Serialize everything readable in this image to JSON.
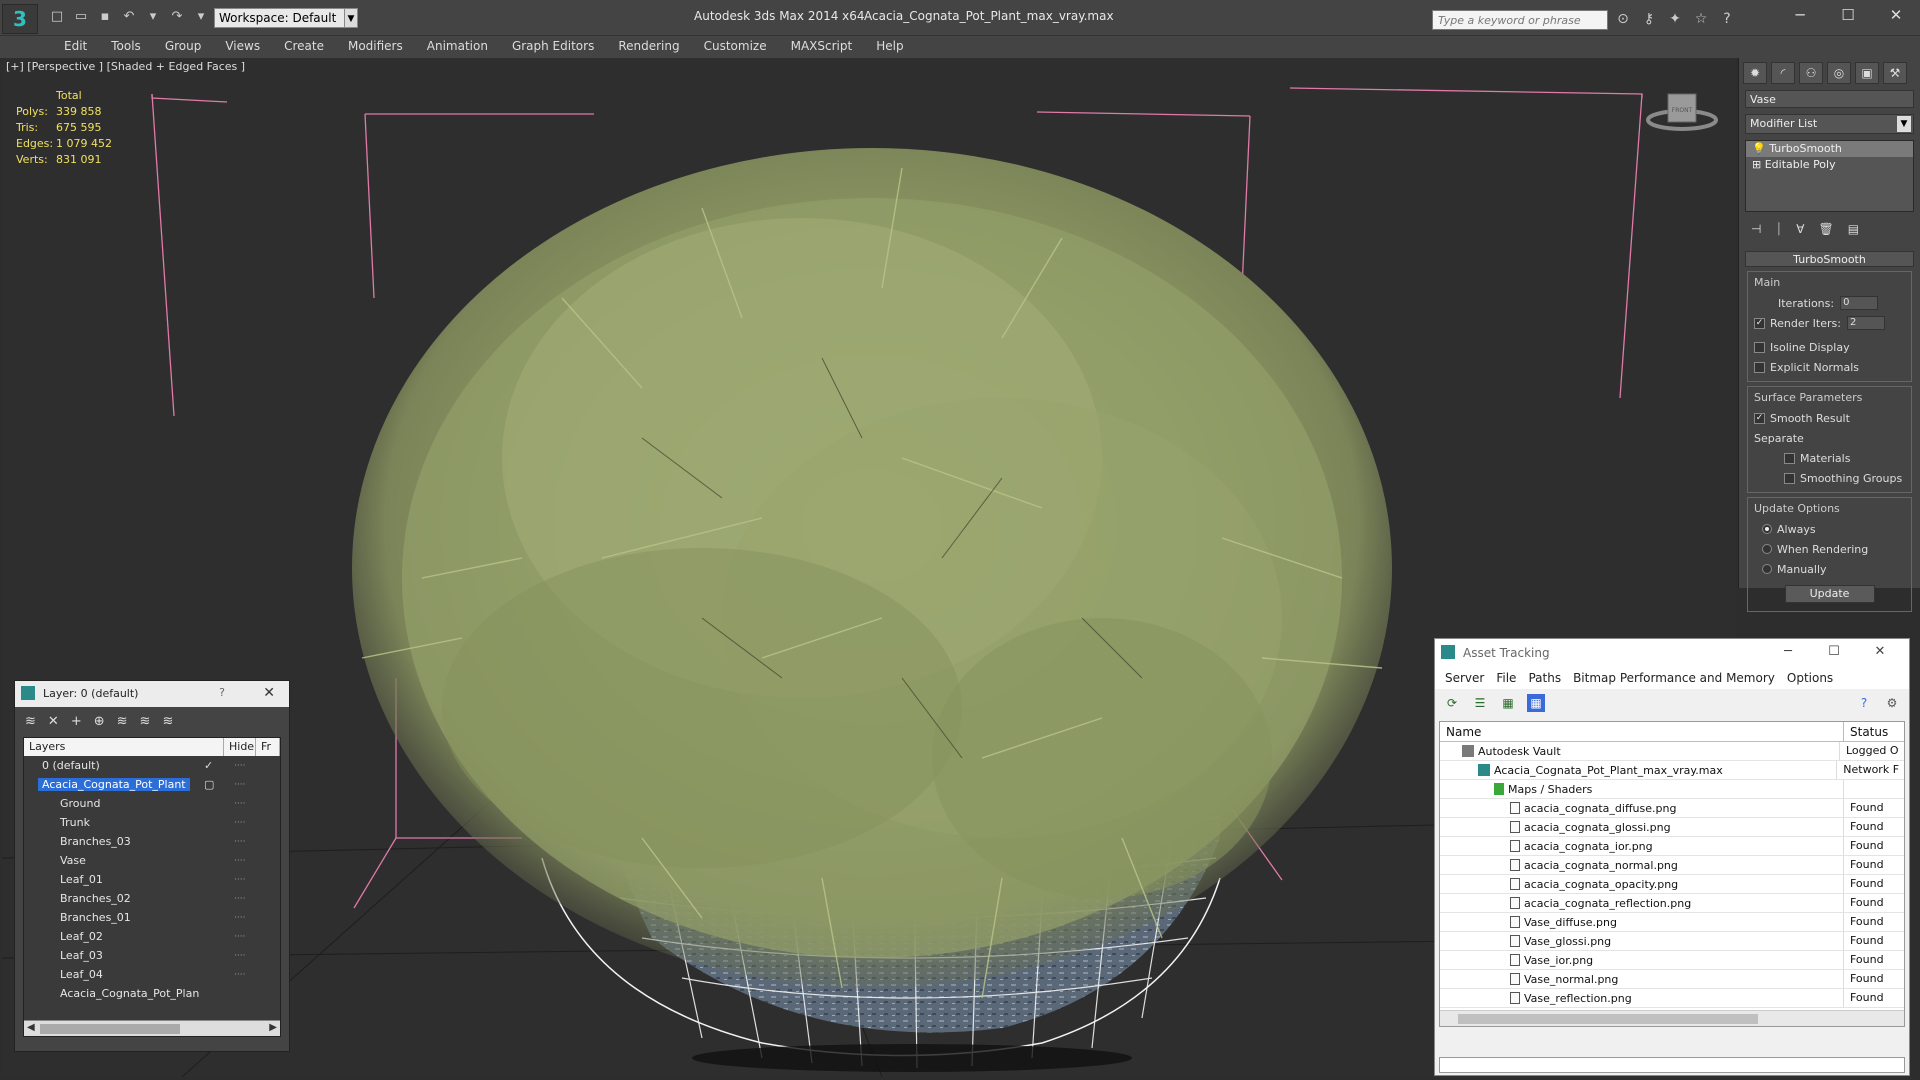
{
  "window": {
    "app_title": "Autodesk 3ds Max  2014 x64",
    "file_name": "Acacia_Cognata_Pot_Plant_max_vray.max",
    "workspace": "Workspace: Default",
    "search_placeholder": "Type a keyword or phrase"
  },
  "menu": [
    "Edit",
    "Tools",
    "Group",
    "Views",
    "Create",
    "Modifiers",
    "Animation",
    "Graph Editors",
    "Rendering",
    "Customize",
    "MAXScript",
    "Help"
  ],
  "viewport": {
    "label": "[+] [Perspective ] [Shaded + Edged Faces ]",
    "stats": {
      "header": "Total",
      "polys_label": "Polys:",
      "polys": "339 858",
      "tris_label": "Tris:",
      "tris": "675 595",
      "edges_label": "Edges:",
      "edges": "1 079 452",
      "verts_label": "Verts:",
      "verts": "831 091"
    },
    "viewcube_label": "FRONT"
  },
  "command_panel": {
    "object_name": "Vase",
    "modifier_list": "Modifier List",
    "stack": [
      "TurboSmooth",
      "Editable Poly"
    ],
    "rollout_title": "TurboSmooth",
    "main_group": "Main",
    "iterations_label": "Iterations:",
    "iterations": "0",
    "render_iters_label": "Render Iters:",
    "render_iters": "2",
    "isoline": "Isoline Display",
    "explicit_normals": "Explicit Normals",
    "surface_group": "Surface Parameters",
    "smooth_result": "Smooth Result",
    "separate": "Separate",
    "materials": "Materials",
    "smoothing_groups": "Smoothing Groups",
    "update_group": "Update Options",
    "always": "Always",
    "when_rendering": "When Rendering",
    "manually": "Manually",
    "update_btn": "Update"
  },
  "layer_window": {
    "title": "Layer: 0 (default)",
    "col_layers": "Layers",
    "col_hide": "Hide",
    "col_freeze": "Fr",
    "rows": [
      "0 (default)",
      "Acacia_Cognata_Pot_Plant",
      "Ground",
      "Trunk",
      "Branches_03",
      "Vase",
      "Leaf_01",
      "Branches_02",
      "Branches_01",
      "Leaf_02",
      "Leaf_03",
      "Leaf_04",
      "Acacia_Cognata_Pot_Plan"
    ]
  },
  "asset_window": {
    "title": "Asset Tracking",
    "menu": [
      "Server",
      "File",
      "Paths",
      "Bitmap Performance and Memory",
      "Options"
    ],
    "col_name": "Name",
    "col_status": "Status",
    "rows": [
      {
        "name": "Autodesk Vault",
        "status": "Logged O"
      },
      {
        "name": "Acacia_Cognata_Pot_Plant_max_vray.max",
        "status": "Network F"
      },
      {
        "name": "Maps / Shaders",
        "status": ""
      },
      {
        "name": "acacia_cognata_diffuse.png",
        "status": "Found"
      },
      {
        "name": "acacia_cognata_glossi.png",
        "status": "Found"
      },
      {
        "name": "acacia_cognata_ior.png",
        "status": "Found"
      },
      {
        "name": "acacia_cognata_normal.png",
        "status": "Found"
      },
      {
        "name": "acacia_cognata_opacity.png",
        "status": "Found"
      },
      {
        "name": "acacia_cognata_reflection.png",
        "status": "Found"
      },
      {
        "name": "Vase_diffuse.png",
        "status": "Found"
      },
      {
        "name": "Vase_glossi.png",
        "status": "Found"
      },
      {
        "name": "Vase_ior.png",
        "status": "Found"
      },
      {
        "name": "Vase_normal.png",
        "status": "Found"
      },
      {
        "name": "Vase_reflection.png",
        "status": "Found"
      }
    ]
  }
}
